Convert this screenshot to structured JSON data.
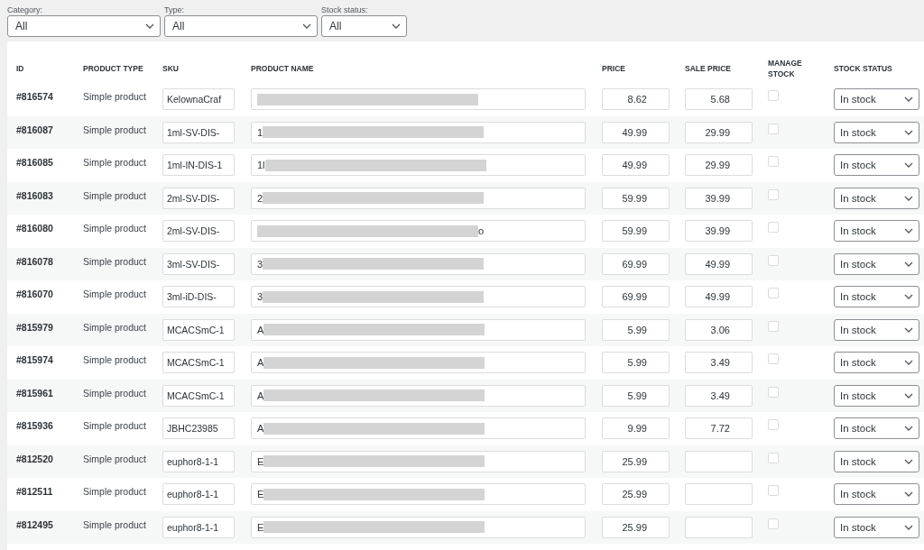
{
  "filters": [
    {
      "label": "Category:",
      "value": "All"
    },
    {
      "label": "Type:",
      "value": "All"
    },
    {
      "label": "Stock status:",
      "value": "All"
    }
  ],
  "columns": [
    "ID",
    "PRODUCT TYPE",
    "SKU",
    "PRODUCT NAME",
    "PRICE",
    "SALE PRICE",
    "MANAGE STOCK",
    "STOCK STATUS"
  ],
  "rows": [
    {
      "id": "#816574",
      "type": "Simple product",
      "sku": "KelownaCraf",
      "price": "8.62",
      "sale_price": "5.68",
      "manage_stock": false,
      "stock_status": "In stock"
    },
    {
      "id": "#816087",
      "type": "Simple product",
      "sku": "1ml-SV-DIS-",
      "name_start": "1",
      "price": "49.99",
      "sale_price": "29.99",
      "manage_stock": false,
      "stock_status": "In stock"
    },
    {
      "id": "#816085",
      "type": "Simple product",
      "sku": "1ml-IN-DIS-1",
      "name_start": "1l",
      "price": "49.99",
      "sale_price": "29.99",
      "manage_stock": false,
      "stock_status": "In stock"
    },
    {
      "id": "#816083",
      "type": "Simple product",
      "sku": "2ml-SV-DIS-",
      "name_start": "2",
      "price": "59.99",
      "sale_price": "39.99",
      "manage_stock": false,
      "stock_status": "In stock"
    },
    {
      "id": "#816080",
      "type": "Simple product",
      "sku": "2ml-SV-DIS-",
      "name_end": "o",
      "price": "59.99",
      "sale_price": "39.99",
      "manage_stock": false,
      "stock_status": "In stock"
    },
    {
      "id": "#816078",
      "type": "Simple product",
      "sku": "3ml-SV-DIS-",
      "name_start": "3",
      "price": "69.99",
      "sale_price": "49.99",
      "manage_stock": false,
      "stock_status": "In stock"
    },
    {
      "id": "#816070",
      "type": "Simple product",
      "sku": "3ml-iD-DIS-",
      "name_start": "3",
      "price": "69.99",
      "sale_price": "49.99",
      "manage_stock": false,
      "stock_status": "In stock"
    },
    {
      "id": "#815979",
      "type": "Simple product",
      "sku": "MCACSmC-1",
      "name_start": "A",
      "price": "5.99",
      "sale_price": "3.06",
      "manage_stock": false,
      "stock_status": "In stock"
    },
    {
      "id": "#815974",
      "type": "Simple product",
      "sku": "MCACSmC-1",
      "name_start": "A",
      "price": "5.99",
      "sale_price": "3.49",
      "manage_stock": false,
      "stock_status": "In stock"
    },
    {
      "id": "#815961",
      "type": "Simple product",
      "sku": "MCACSmC-1",
      "name_start": "A",
      "price": "5.99",
      "sale_price": "3.49",
      "manage_stock": false,
      "stock_status": "In stock"
    },
    {
      "id": "#815936",
      "type": "Simple product",
      "sku": "JBHC23985",
      "name_start": "A",
      "price": "9.99",
      "sale_price": "7.72",
      "manage_stock": false,
      "stock_status": "In stock"
    },
    {
      "id": "#812520",
      "type": "Simple product",
      "sku": "euphor8-1-1",
      "name_start": "E",
      "price": "25.99",
      "manage_stock": false,
      "stock_status": "In stock"
    },
    {
      "id": "#812511",
      "type": "Simple product",
      "sku": "euphor8-1-1",
      "name_start": "E",
      "price": "25.99",
      "manage_stock": false,
      "stock_status": "In stock"
    },
    {
      "id": "#812495",
      "type": "Simple product",
      "sku": "euphor8-1-1",
      "name_start": "E",
      "price": "25.99",
      "manage_stock": false,
      "stock_status": "In stock"
    }
  ]
}
